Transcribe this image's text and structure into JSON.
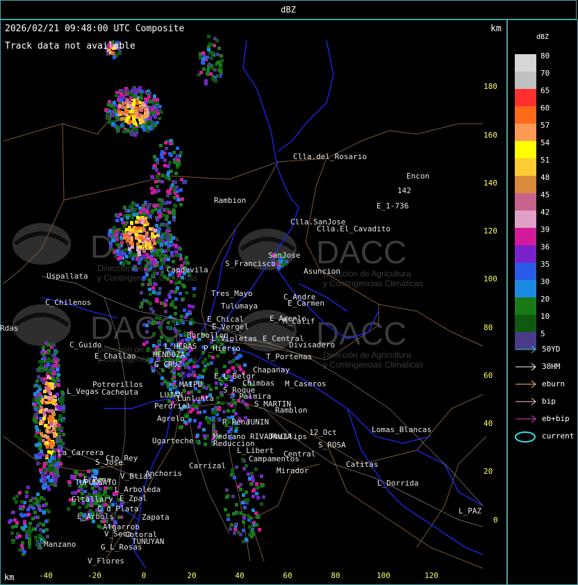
{
  "top_bar": {
    "title": "dBZ"
  },
  "header": {
    "timestamp": "2026/02/21 09:48:00 UTC Composite",
    "track_status": "Track data not available",
    "km_label": "km"
  },
  "x_axis": {
    "unit": "km",
    "ticks": [
      "-40",
      "-20",
      "0",
      "20",
      "40",
      "60",
      "80",
      "100",
      "120"
    ]
  },
  "y_axis": {
    "ticks": [
      "180",
      "160",
      "140",
      "120",
      "100",
      "80",
      "60",
      "40",
      "20",
      "0"
    ]
  },
  "legend": {
    "title": "dBZ",
    "scale": [
      {
        "value": "80",
        "color": "#d7d7d7"
      },
      {
        "value": "70",
        "color": "#c0c0c0"
      },
      {
        "value": "65",
        "color": "#ff3030"
      },
      {
        "value": "60",
        "color": "#ff6a1a"
      },
      {
        "value": "57",
        "color": "#ff9a55"
      },
      {
        "value": "54",
        "color": "#ffff00"
      },
      {
        "value": "51",
        "color": "#ffcc33"
      },
      {
        "value": "48",
        "color": "#d98a3a"
      },
      {
        "value": "45",
        "color": "#c8638c"
      },
      {
        "value": "42",
        "color": "#e0a0c8"
      },
      {
        "value": "39",
        "color": "#d21a9a"
      },
      {
        "value": "36",
        "color": "#7a22cc"
      },
      {
        "value": "35",
        "color": "#2a5ae8"
      },
      {
        "value": "30",
        "color": "#1c8ae0"
      },
      {
        "value": "20",
        "color": "#1a7a1a"
      },
      {
        "value": "10",
        "color": "#0f5a10"
      },
      {
        "value": "5",
        "color": "#4a3a8a"
      }
    ],
    "tracks": [
      {
        "label": "50YD",
        "color": "#38d0d8"
      },
      {
        "label": "30HM",
        "color": "#ffffff"
      },
      {
        "label": "eburn",
        "color": "#ffc070"
      },
      {
        "label": "bip",
        "color": "#ffc8d8"
      },
      {
        "label": "eb+bip",
        "color": "#e040e0"
      },
      {
        "label": "current",
        "color": "#38e0e8"
      }
    ]
  },
  "watermark": {
    "brand": "DACC",
    "line1": "Dirección de Agricultura",
    "line2": "y Contingencias Climáticas"
  },
  "towns": [
    "Clla.del_Rosario",
    "Encon",
    "142",
    "E_1-736",
    "Rambion",
    "Clla.SanJose",
    "Clla.El_Cavadito",
    "SanJose",
    "Uspallata",
    "Capdevila",
    "S_Francisco",
    "Asuncion",
    "Tres_Mayo",
    "C_Andre",
    "C_Chilenos",
    "Tulumaya",
    "E_Carmen",
    "E_Chical",
    "E_Arenlo",
    "Rdas",
    "E_Vergel",
    "M_Calif",
    "Borbollon",
    "L_Violetas",
    "E_Central",
    "Divisadero",
    "C_Guido",
    "L_HERAS",
    "P_Hierro",
    "T_Portenas",
    "E_Challao",
    "MENDOZA",
    "Chapanay",
    "G_CRUZ",
    "E_L_Belgr",
    "Chimbas",
    "M_Caseros",
    "Potrerillos",
    "MAIPU",
    "S_Roque",
    "L_Vegas",
    "Cacheuta",
    "Palmira",
    "LUJAN",
    "Lunlunta",
    "S_MARTIN",
    "Perdriel",
    "Ramblon",
    "Agrelo",
    "R_Pena",
    "JUNIN",
    "12_Oct",
    "Lomas_Blancas",
    "Ugarteche",
    "Medrano",
    "RIVADAVIA",
    "Phillips",
    "S_ROSA",
    "Reduccion",
    "Cto_Rey",
    "L_Libert",
    "Central",
    "La_Carrera",
    "S_Jose",
    "Carrizal",
    "Campamentos",
    "Catitas",
    "Anchoris",
    "Mirador",
    "E_Pena",
    "V_Btias",
    "TUPUNGATO",
    "L_Dorrida",
    "L_Arboleda",
    "Gltallary",
    "E_Zpal",
    "C_d_Plata",
    "L_Arbols",
    "Zapata",
    "L_PAZ",
    "Algarrob",
    "V_Seca",
    "Cotoral",
    "TUNUYAN",
    "Manzano",
    "G_L_Rosas",
    "V_Flores"
  ]
}
